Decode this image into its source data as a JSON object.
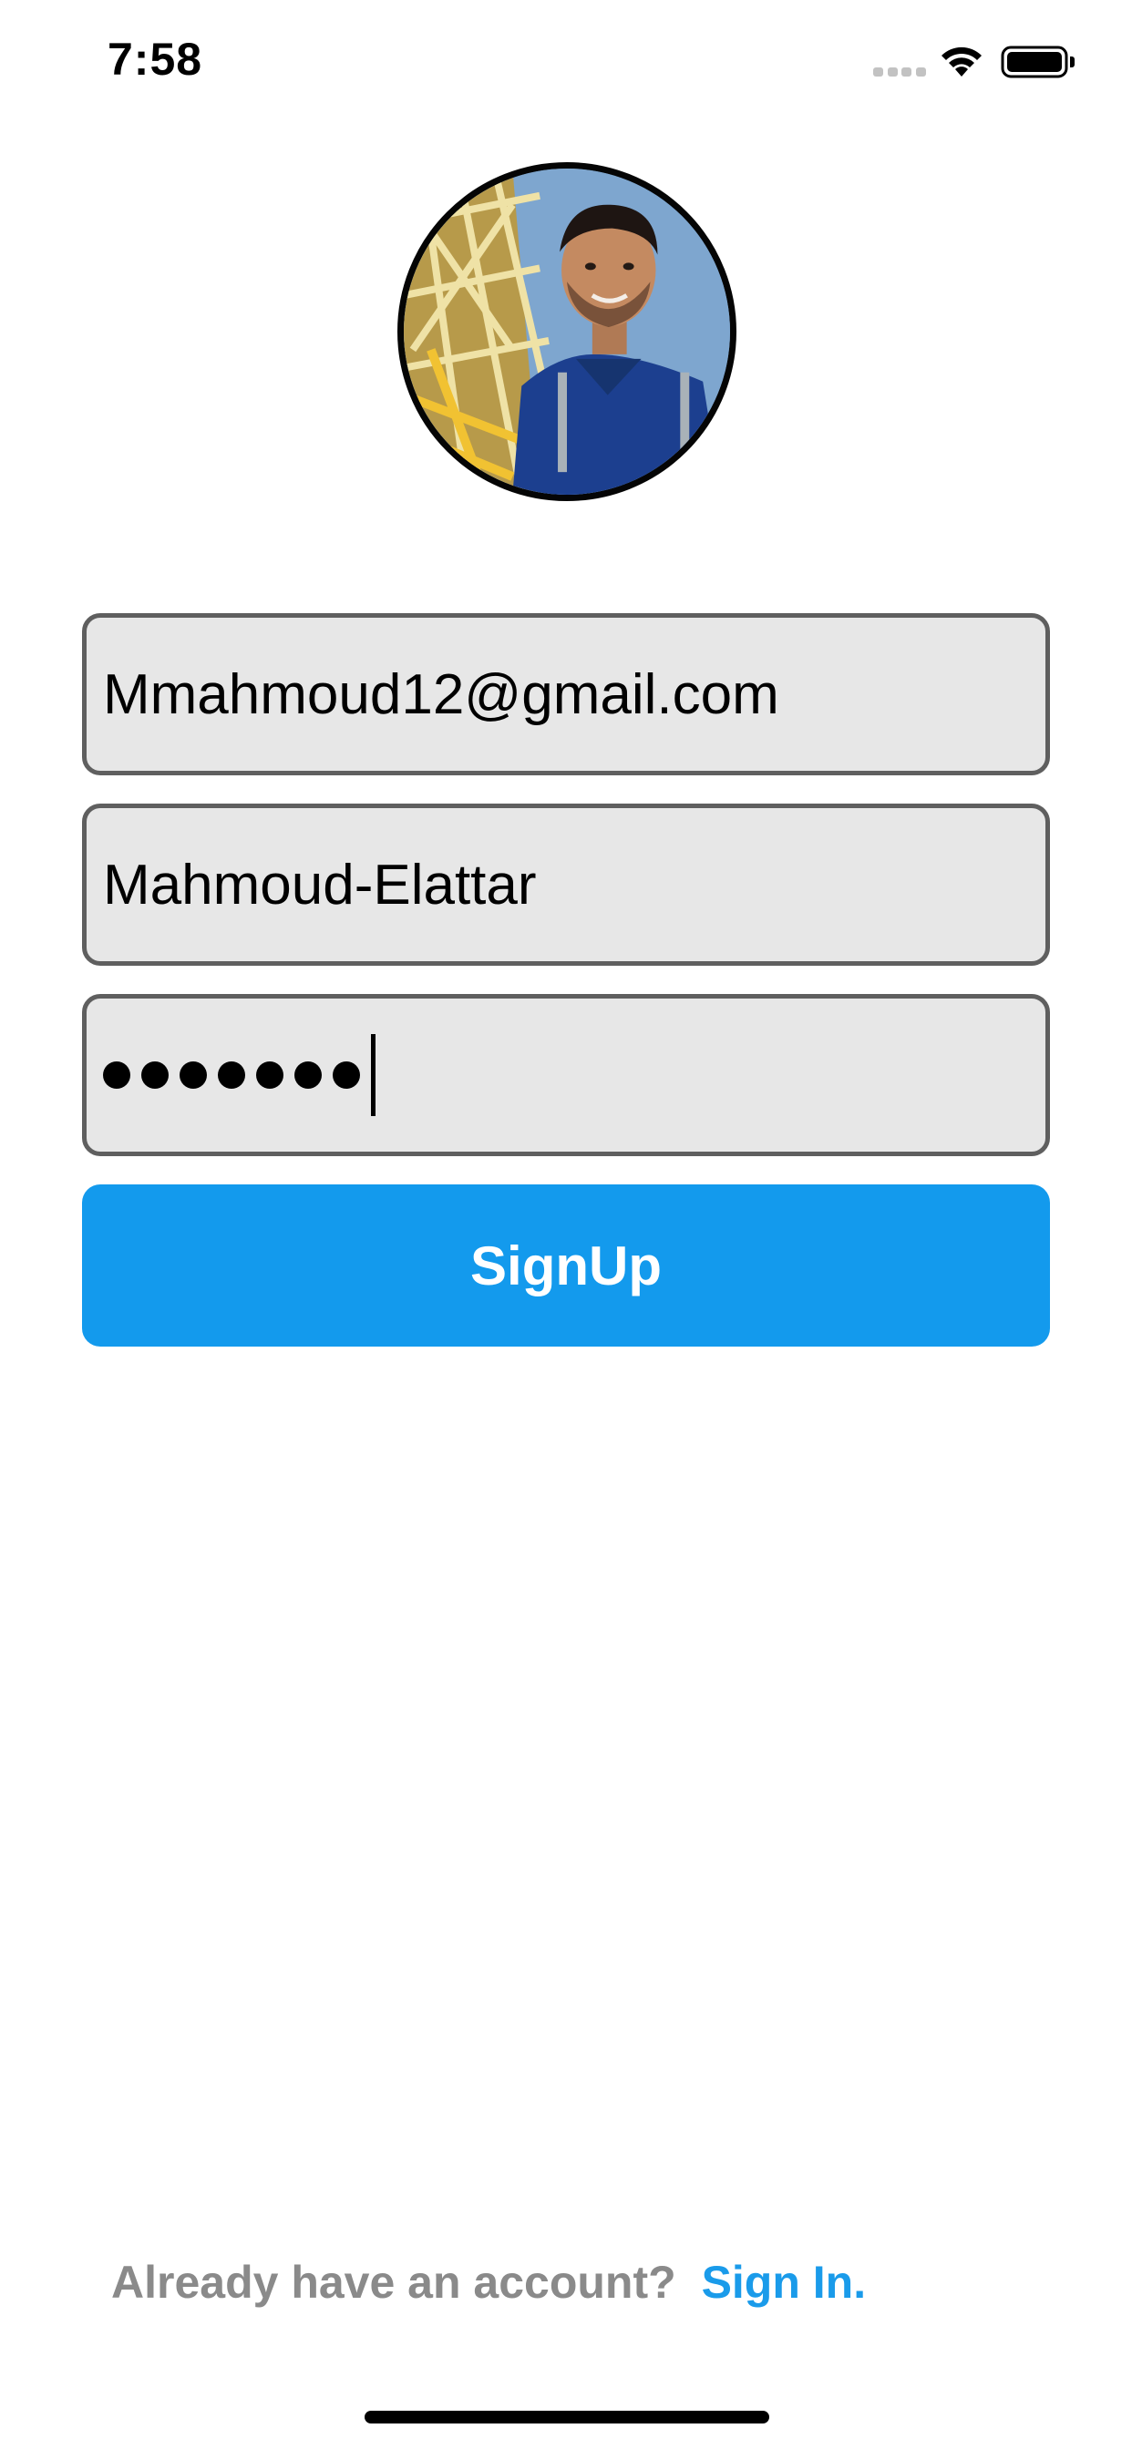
{
  "status_bar": {
    "time": "7:58"
  },
  "profile": {
    "avatar_alt": ""
  },
  "form": {
    "email_value": "Mmahmoud12@gmail.com",
    "username_value": "Mahmoud-Elattar",
    "password_masked_count": 7,
    "signup_label": "SignUp"
  },
  "footer": {
    "prompt": "Already have an account?",
    "link": "Sign In."
  },
  "colors": {
    "accent": "#139aed",
    "link": "#1a9bea",
    "field_bg": "#e7e7e7",
    "field_border": "#5f5f5f"
  },
  "icons": {
    "signal": "signal-dots-icon",
    "wifi": "wifi-icon",
    "battery": "battery-icon"
  }
}
